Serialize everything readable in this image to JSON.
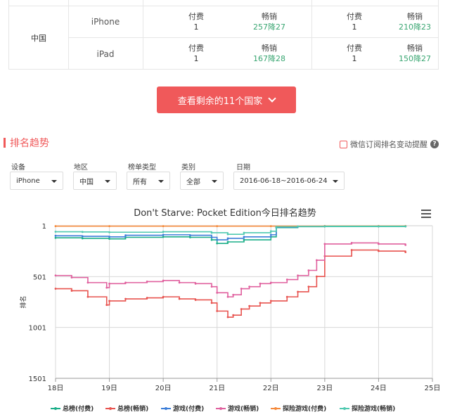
{
  "rank_table": {
    "country": "中国",
    "rows": [
      {
        "device": "iPhone",
        "cells": [
          {
            "label": "付费",
            "value": "1",
            "green": false
          },
          {
            "label": "畅销",
            "value": "257降27",
            "green": true
          },
          {
            "label": "付费",
            "value": "1",
            "green": false
          },
          {
            "label": "畅销",
            "value": "210降23",
            "green": true
          }
        ]
      },
      {
        "device": "iPad",
        "cells": [
          {
            "label": "付费",
            "value": "1",
            "green": false
          },
          {
            "label": "畅销",
            "value": "167降28",
            "green": true
          },
          {
            "label": "付费",
            "value": "1",
            "green": false
          },
          {
            "label": "畅销",
            "value": "150降27",
            "green": true
          }
        ]
      }
    ]
  },
  "show_more": {
    "label": "查看剩余的11个国家"
  },
  "section": {
    "title": "排名趋势",
    "wechat_label": "微信订阅排名变动提醒",
    "help": "?"
  },
  "filters": {
    "device": {
      "label": "设备",
      "value": "iPhone"
    },
    "region": {
      "label": "地区",
      "value": "中国"
    },
    "list_type": {
      "label": "榜单类型",
      "value": "所有"
    },
    "category": {
      "label": "类别",
      "value": "全部"
    },
    "date": {
      "label": "日期",
      "value": "2016-06-18~2016-06-24"
    }
  },
  "chart_data": {
    "type": "line",
    "title": "Don't Starve: Pocket Edition今日排名趋势",
    "ylabel": "排名",
    "ylim": [
      1,
      1501
    ],
    "y_reversed": true,
    "y_ticks": [
      "1",
      "501",
      "1001",
      "1501"
    ],
    "x_ticks": [
      "18日",
      "19日",
      "20日",
      "21日",
      "22日",
      "23日",
      "24日",
      "25日"
    ],
    "xlim": [
      0,
      7
    ],
    "series": [
      {
        "name": "总榜(付费)",
        "color": "#1aae88",
        "x": [
          0,
          0.5,
          1,
          1.3,
          2,
          2.5,
          2.9,
          3.0,
          3.2,
          3.5,
          4.0,
          4.1,
          4.5,
          5,
          6,
          6.5
        ],
        "y": [
          120,
          125,
          130,
          115,
          110,
          115,
          140,
          175,
          160,
          140,
          110,
          20,
          10,
          8,
          8,
          8
        ]
      },
      {
        "name": "总榜(畅销)",
        "color": "#e8534f",
        "x": [
          0,
          0.3,
          0.6,
          0.95,
          1.0,
          1.3,
          1.7,
          2.0,
          2.3,
          2.6,
          2.9,
          3.0,
          3.2,
          3.3,
          3.45,
          3.6,
          3.8,
          4.0,
          4.3,
          4.5,
          4.7,
          4.85,
          5.0,
          5.5,
          6.0,
          6.5
        ],
        "y": [
          620,
          640,
          700,
          780,
          740,
          720,
          710,
          700,
          720,
          730,
          760,
          840,
          900,
          880,
          820,
          790,
          760,
          740,
          700,
          650,
          600,
          500,
          300,
          240,
          250,
          260
        ]
      },
      {
        "name": "游戏(付费)",
        "color": "#3b7dd8",
        "x": [
          0,
          0.5,
          1,
          1.3,
          2,
          2.5,
          2.9,
          3.0,
          3.2,
          3.5,
          4.0,
          4.1,
          4.5,
          5,
          6,
          6.5
        ],
        "y": [
          100,
          105,
          110,
          95,
          90,
          95,
          115,
          140,
          125,
          110,
          90,
          15,
          8,
          5,
          5,
          5
        ]
      },
      {
        "name": "游戏(畅销)",
        "color": "#e0609e",
        "x": [
          0,
          0.3,
          0.6,
          0.95,
          1.0,
          1.3,
          1.7,
          2.0,
          2.3,
          2.6,
          2.9,
          3.0,
          3.2,
          3.3,
          3.45,
          3.6,
          3.8,
          4.0,
          4.3,
          4.5,
          4.7,
          4.85,
          5.0,
          5.5,
          6.0,
          6.5
        ],
        "y": [
          490,
          510,
          560,
          610,
          570,
          560,
          550,
          540,
          560,
          570,
          600,
          660,
          700,
          680,
          620,
          600,
          570,
          560,
          530,
          490,
          440,
          340,
          180,
          170,
          180,
          190
        ]
      },
      {
        "name": "探险游戏(付费)",
        "color": "#f5893a",
        "x": [
          0,
          1,
          2,
          3,
          4,
          5,
          6,
          6.5
        ],
        "y": [
          5,
          5,
          5,
          5,
          5,
          3,
          3,
          3
        ]
      },
      {
        "name": "探险游戏(畅销)",
        "color": "#4fc9b0",
        "x": [
          0,
          0.5,
          1,
          2,
          2.9,
          3.2,
          3.5,
          4.0,
          4.1,
          4.5,
          5,
          6,
          6.5
        ],
        "y": [
          60,
          62,
          65,
          60,
          70,
          85,
          70,
          55,
          12,
          8,
          6,
          6,
          6
        ]
      }
    ]
  }
}
